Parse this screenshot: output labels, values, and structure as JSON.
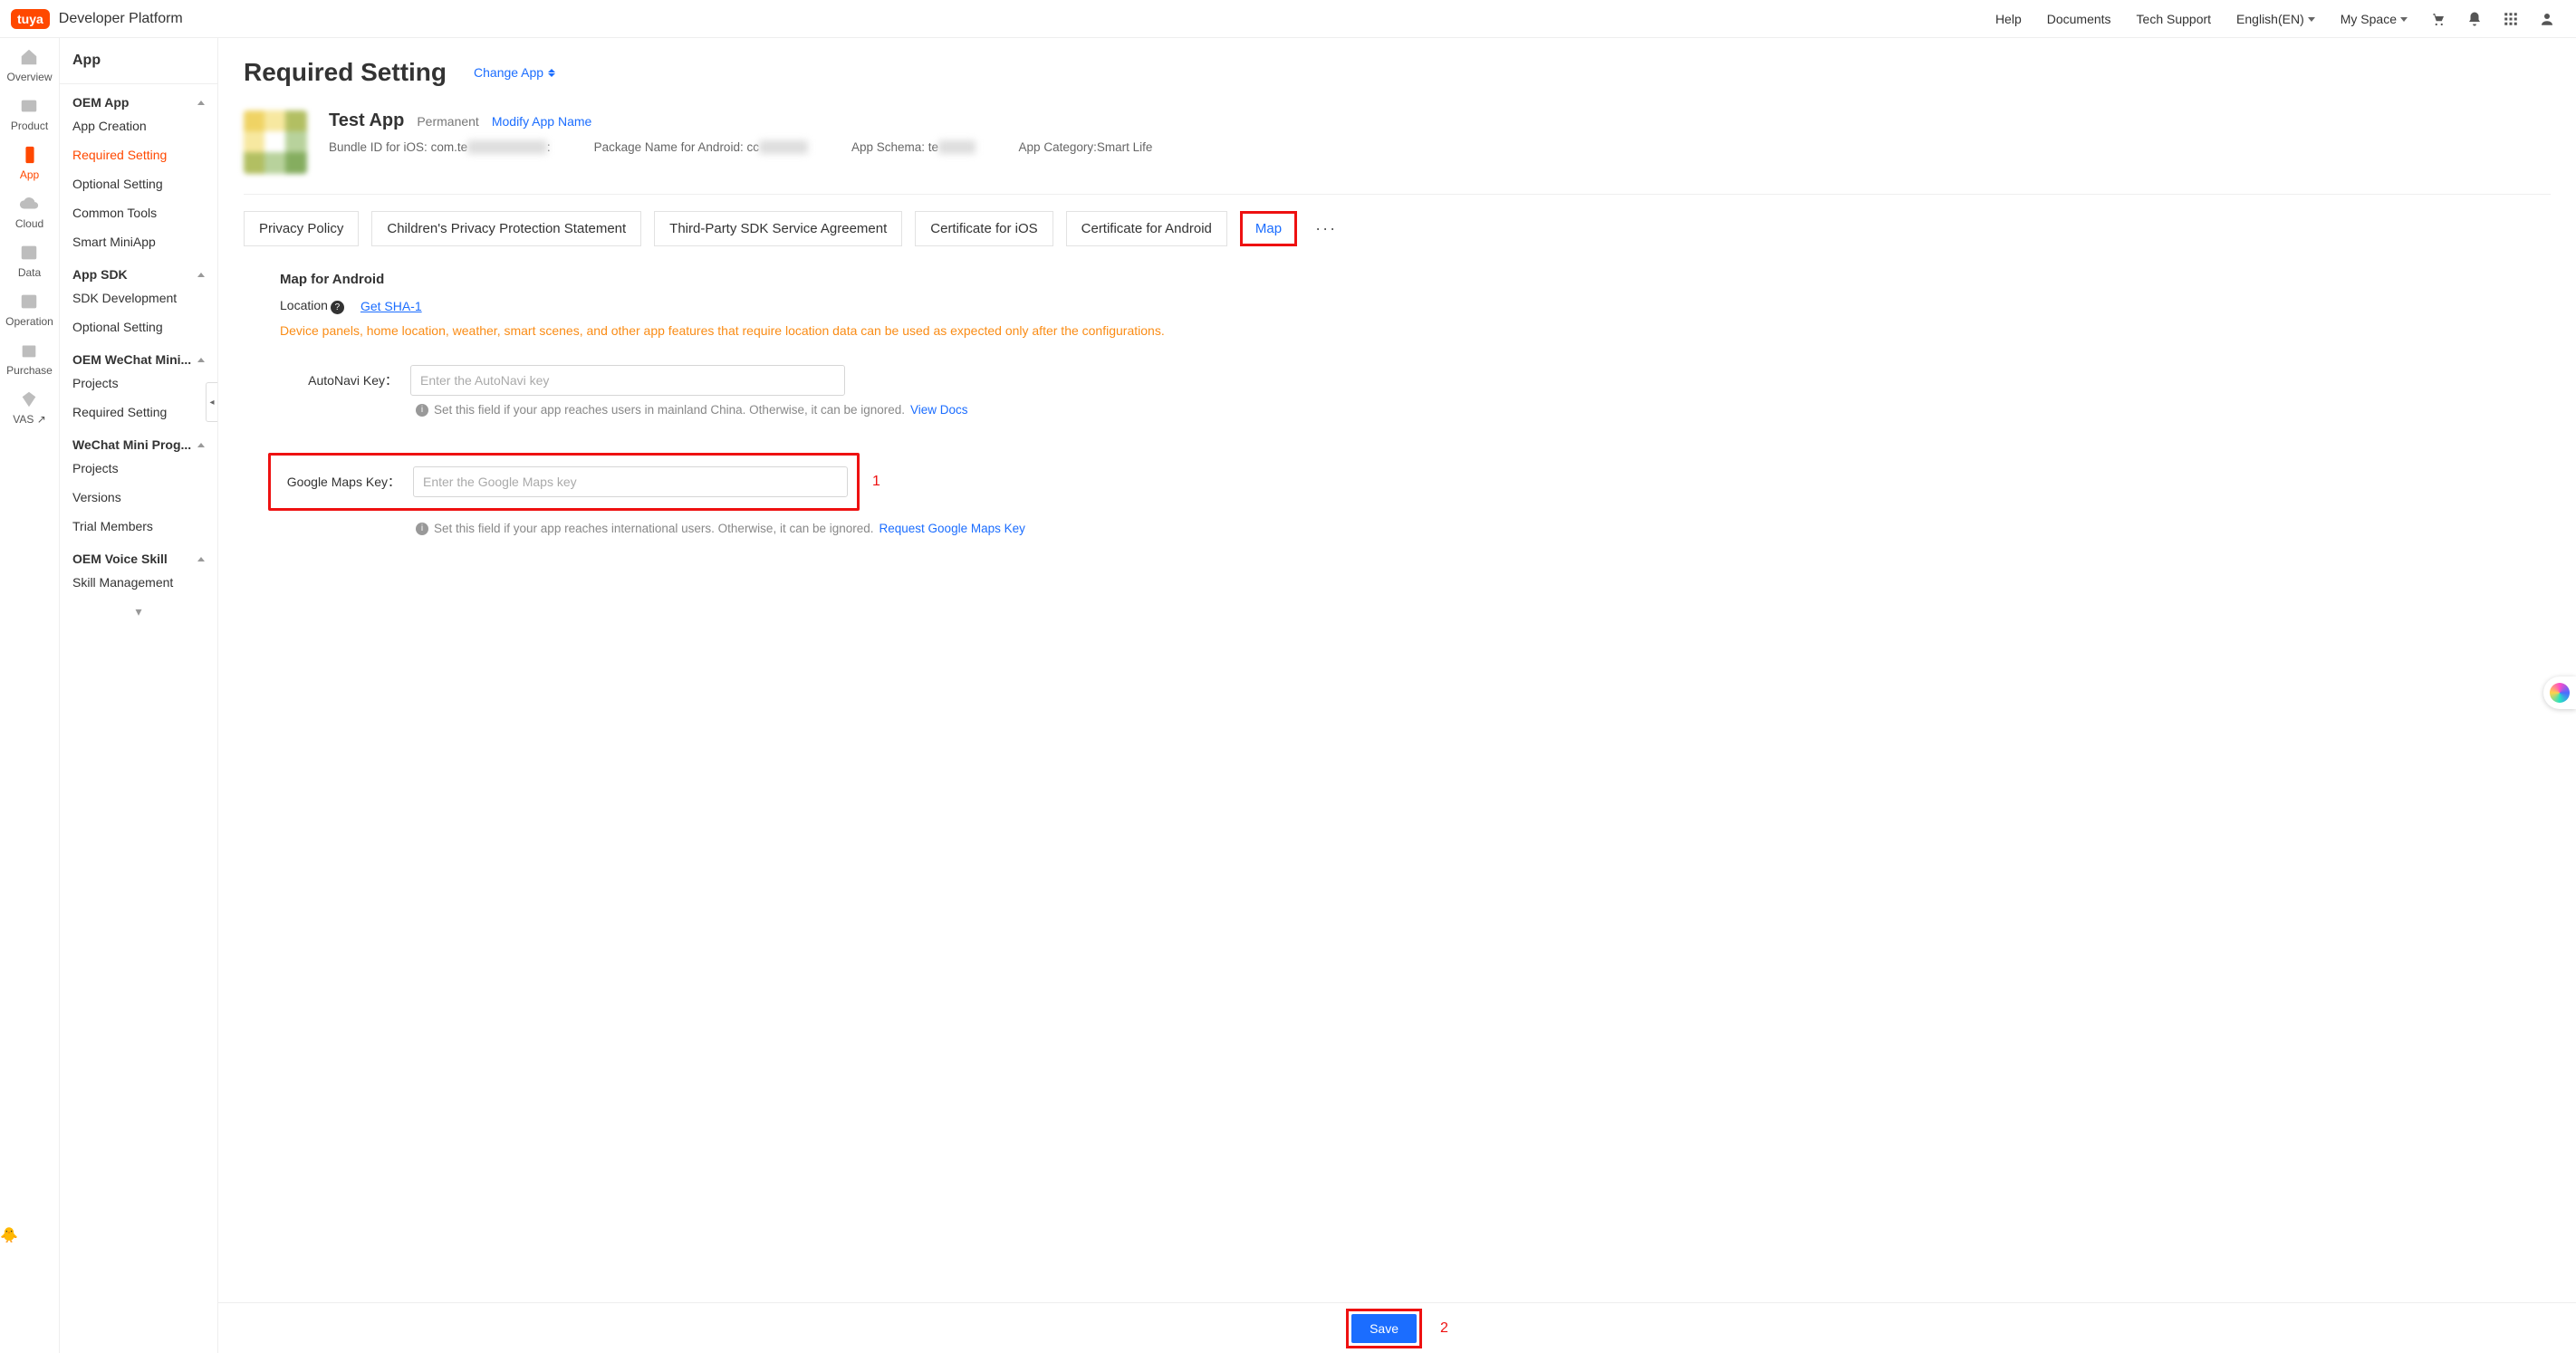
{
  "brand": {
    "logo_text": "tuya",
    "platform": "Developer Platform"
  },
  "topnav": {
    "help": "Help",
    "documents": "Documents",
    "techsupport": "Tech Support",
    "language": "English(EN)",
    "myspace": "My Space"
  },
  "rail": {
    "overview": "Overview",
    "product": "Product",
    "app": "App",
    "cloud": "Cloud",
    "data": "Data",
    "operation": "Operation",
    "purchase": "Purchase",
    "vas": "VAS ↗"
  },
  "sidebar": {
    "title": "App",
    "groups": {
      "oem_app": "OEM App",
      "app_sdk": "App SDK",
      "oem_wechat": "OEM WeChat Mini...",
      "wechat_prog": "WeChat Mini Prog...",
      "oem_voice": "OEM Voice Skill"
    },
    "items": {
      "app_creation": "App Creation",
      "required_setting": "Required Setting",
      "optional_setting": "Optional Setting",
      "common_tools": "Common Tools",
      "smart_miniapp": "Smart MiniApp",
      "sdk_dev": "SDK Development",
      "optional_setting2": "Optional Setting",
      "projects": "Projects",
      "required_setting2": "Required Setting",
      "projects2": "Projects",
      "versions": "Versions",
      "trial_members": "Trial Members",
      "skill_mgmt": "Skill Management"
    }
  },
  "page": {
    "title": "Required Setting",
    "change_app": "Change App"
  },
  "app": {
    "name": "Test App",
    "permanent": "Permanent",
    "modify_link": "Modify App Name",
    "bundle_label": "Bundle ID for iOS:",
    "bundle_value": "com.te",
    "pkg_label": "Package Name for Android:",
    "pkg_value": "cc",
    "schema_label": "App Schema:",
    "schema_value": "te",
    "category_label": "App Category:",
    "category_value": "Smart Life"
  },
  "tabs": {
    "privacy": "Privacy Policy",
    "children": "Children's Privacy Protection Statement",
    "thirdparty": "Third-Party SDK Service Agreement",
    "cert_ios": "Certificate for iOS",
    "cert_android": "Certificate for Android",
    "map": "Map",
    "more": "···"
  },
  "map_panel": {
    "heading": "Map for Android",
    "location_label": "Location",
    "get_sha1": "Get SHA-1",
    "warning": "Device panels, home location, weather, smart scenes, and other app features that require location data can be used as expected only after the configurations.",
    "autonavi": {
      "label": "AutoNavi Key：",
      "placeholder": "Enter the AutoNavi key",
      "hint": "Set this field if your app reaches users in mainland China. Otherwise, it can be ignored.",
      "link": "View Docs"
    },
    "google": {
      "label": "Google Maps Key：",
      "placeholder": "Enter the Google Maps key",
      "hint": "Set this field if your app reaches international users. Otherwise, it can be ignored.",
      "link": "Request Google Maps Key"
    }
  },
  "callouts": {
    "one": "1",
    "two": "2"
  },
  "save": {
    "label": "Save"
  }
}
